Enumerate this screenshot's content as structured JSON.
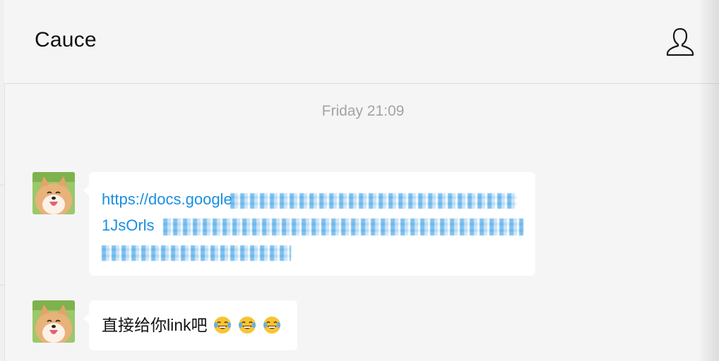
{
  "header": {
    "title": "Cauce",
    "contact_icon": "person-outline-icon"
  },
  "conversation": {
    "timestamp": "Friday 21:09",
    "messages": [
      {
        "sender_avatar": "shiba-dog-avatar",
        "type": "link",
        "visible_text": "https://docs.google\n1JsOrls",
        "obscured": true
      },
      {
        "sender_avatar": "shiba-dog-avatar",
        "type": "text",
        "text": "直接给你link吧",
        "emoji": [
          "tears-of-joy-emoji",
          "tears-of-joy-emoji",
          "tears-of-joy-emoji"
        ]
      }
    ]
  },
  "colors": {
    "background": "#f5f5f5",
    "bubble": "#ffffff",
    "link": "#1a8fe0",
    "timestamp": "#a3a3a3"
  }
}
